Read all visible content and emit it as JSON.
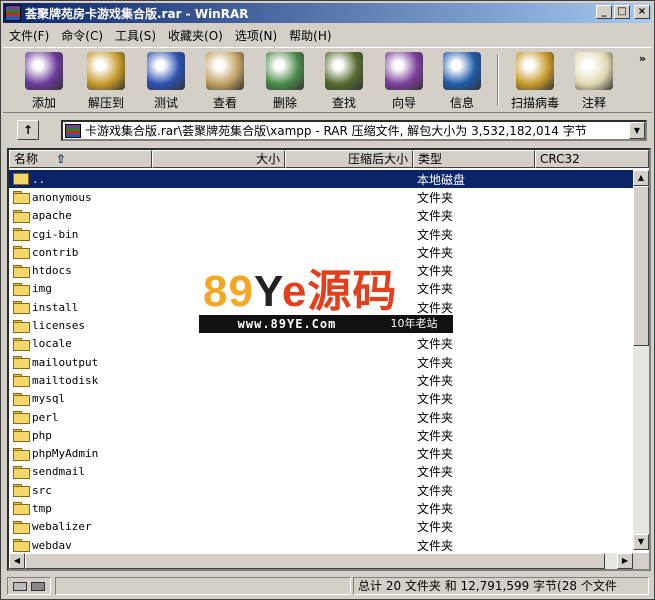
{
  "window": {
    "title": "荟聚牌苑房卡游戏集合版.rar - WinRAR",
    "controls": {
      "minimize": "_",
      "maximize": "□",
      "close": "×"
    }
  },
  "menubar": [
    {
      "label": "文件(F)"
    },
    {
      "label": "命令(C)"
    },
    {
      "label": "工具(S)"
    },
    {
      "label": "收藏夹(O)"
    },
    {
      "label": "选项(N)"
    },
    {
      "label": "帮助(H)"
    }
  ],
  "toolbar": [
    {
      "label": "添加",
      "icon": "add-archive-icon",
      "color": "#6a3a9a"
    },
    {
      "label": "解压到",
      "icon": "extract-icon",
      "color": "#c69a2a"
    },
    {
      "label": "测试",
      "icon": "test-icon",
      "color": "#2a50b0"
    },
    {
      "label": "查看",
      "icon": "view-icon",
      "color": "#c0a060"
    },
    {
      "label": "删除",
      "icon": "delete-icon",
      "color": "#4a8a4a"
    },
    {
      "label": "查找",
      "icon": "find-icon",
      "color": "#556b2f"
    },
    {
      "label": "向导",
      "icon": "wizard-icon",
      "color": "#7a3f9a"
    },
    {
      "label": "信息",
      "icon": "info-icon",
      "color": "#1e5aa8"
    },
    {
      "label": "扫描病毒",
      "icon": "virus-scan-icon",
      "color": "#c69a2a"
    },
    {
      "label": "注释",
      "icon": "comment-icon",
      "color": "#e0d8b0"
    }
  ],
  "toolbar_more": "»",
  "address": {
    "up_label": "↑",
    "path": "卡游戏集合版.rar\\荟聚牌苑集合版\\xampp - RAR 压缩文件, 解包大小为 3,532,182,014 字节"
  },
  "columns": {
    "name": "名称",
    "size": "大小",
    "packed": "压缩后大小",
    "type": "类型",
    "crc": "CRC32"
  },
  "files": [
    {
      "name": "..",
      "type": "本地磁盘",
      "selected": true,
      "updir": true
    },
    {
      "name": "anonymous",
      "type": "文件夹"
    },
    {
      "name": "apache",
      "type": "文件夹"
    },
    {
      "name": "cgi-bin",
      "type": "文件夹"
    },
    {
      "name": "contrib",
      "type": "文件夹"
    },
    {
      "name": "htdocs",
      "type": "文件夹"
    },
    {
      "name": "img",
      "type": "文件夹"
    },
    {
      "name": "install",
      "type": "文件夹"
    },
    {
      "name": "licenses",
      "type": "文件夹"
    },
    {
      "name": "locale",
      "type": "文件夹"
    },
    {
      "name": "mailoutput",
      "type": "文件夹"
    },
    {
      "name": "mailtodisk",
      "type": "文件夹"
    },
    {
      "name": "mysql",
      "type": "文件夹"
    },
    {
      "name": "perl",
      "type": "文件夹"
    },
    {
      "name": "php",
      "type": "文件夹"
    },
    {
      "name": "phpMyAdmin",
      "type": "文件夹"
    },
    {
      "name": "sendmail",
      "type": "文件夹"
    },
    {
      "name": "src",
      "type": "文件夹"
    },
    {
      "name": "tmp",
      "type": "文件夹"
    },
    {
      "name": "webalizer",
      "type": "文件夹"
    },
    {
      "name": "webdav",
      "type": "文件夹"
    }
  ],
  "status": {
    "summary": "总计 20 文件夹 和 12,791,599 字节(28 个文件"
  },
  "watermark": {
    "brand_num": "89",
    "brand_y": "Y",
    "brand_cn": "e源码",
    "url": "www.89YE.Com",
    "tag": "10年老站"
  }
}
